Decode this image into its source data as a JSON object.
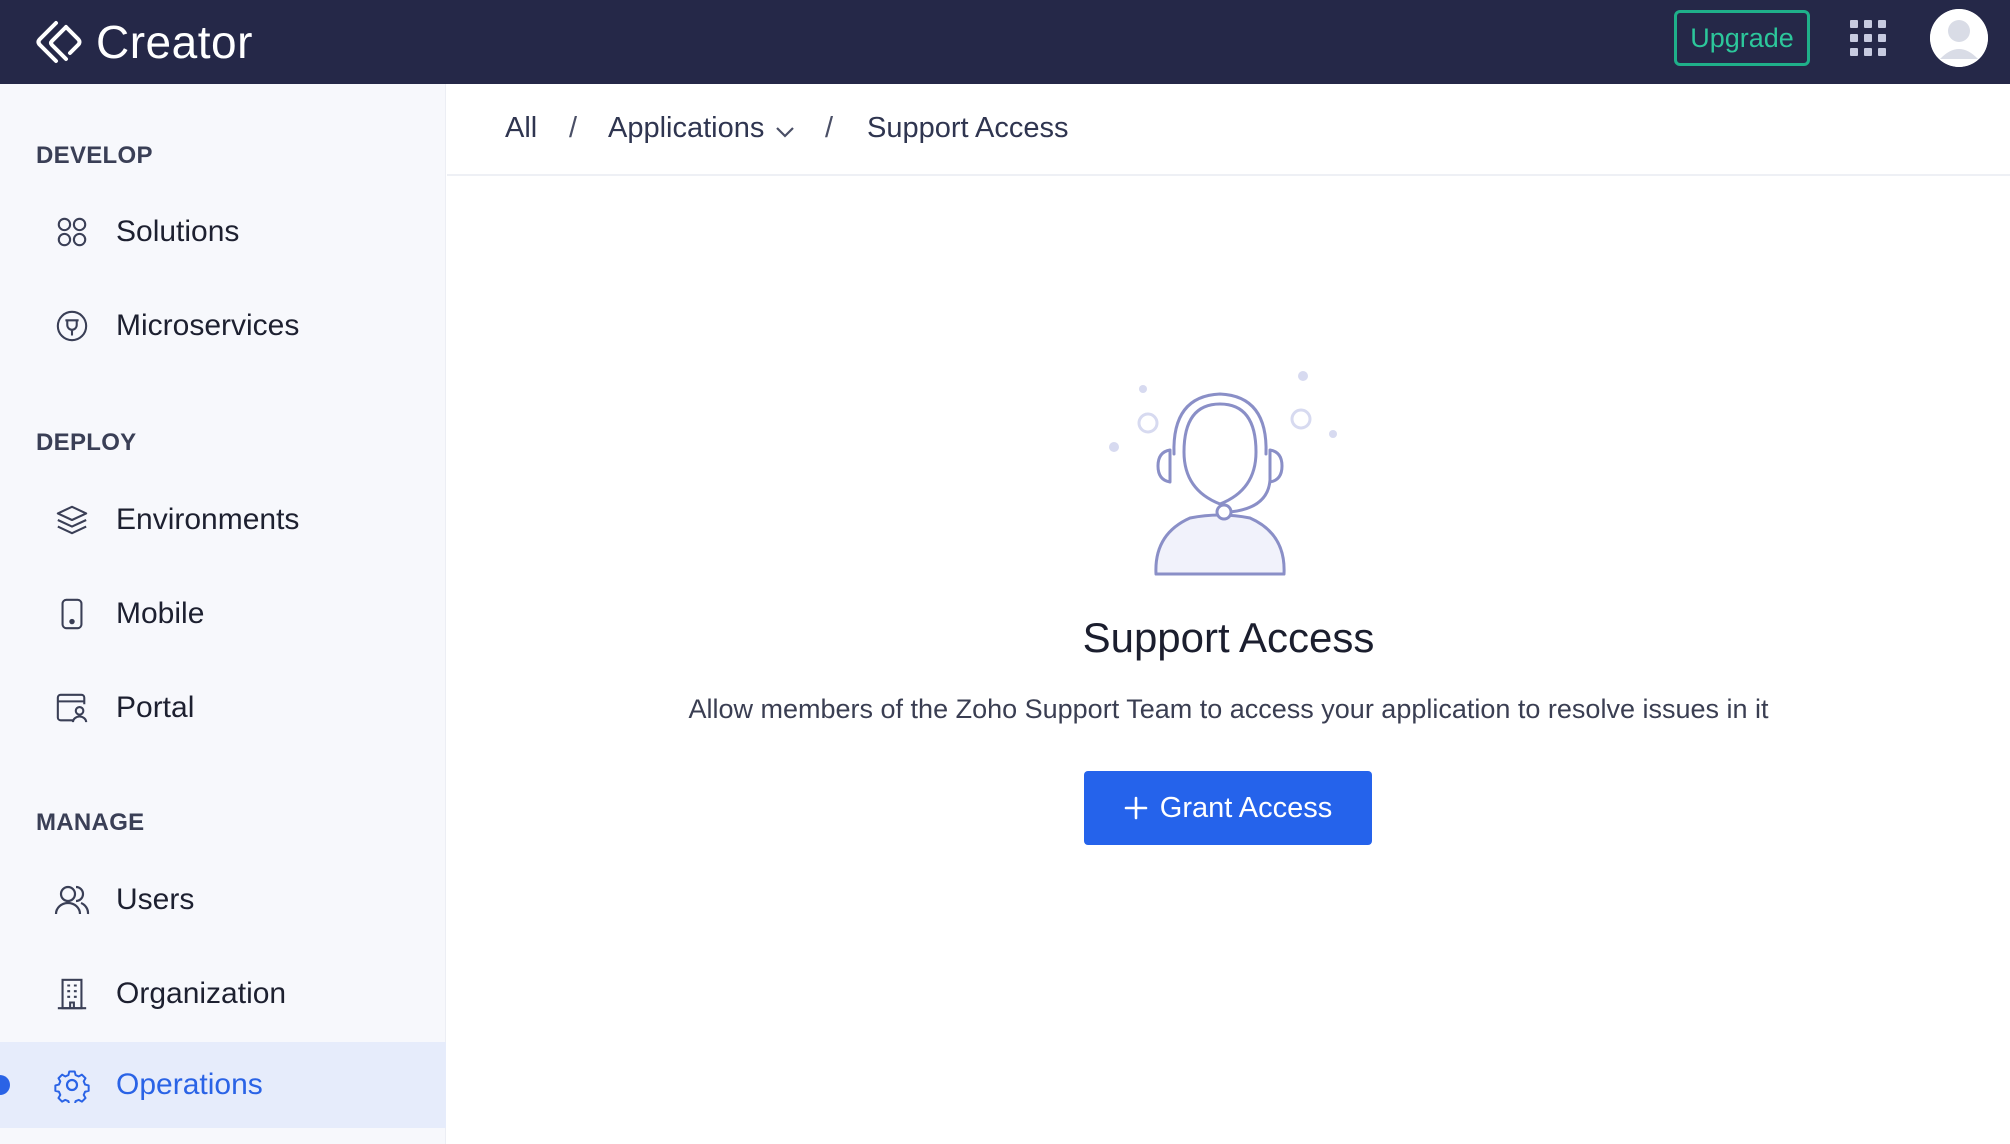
{
  "app": {
    "name": "Creator",
    "upgrade_label": "Upgrade"
  },
  "sidebar": {
    "sections": [
      {
        "title": "DEVELOP",
        "items": [
          {
            "label": "Solutions",
            "icon": "solutions-icon"
          },
          {
            "label": "Microservices",
            "icon": "microservices-icon"
          }
        ]
      },
      {
        "title": "DEPLOY",
        "items": [
          {
            "label": "Environments",
            "icon": "layers-icon"
          },
          {
            "label": "Mobile",
            "icon": "mobile-icon"
          },
          {
            "label": "Portal",
            "icon": "portal-icon"
          }
        ]
      },
      {
        "title": "MANAGE",
        "items": [
          {
            "label": "Users",
            "icon": "users-icon"
          },
          {
            "label": "Organization",
            "icon": "building-icon"
          },
          {
            "label": "Operations",
            "icon": "gear-icon",
            "active": true
          }
        ]
      }
    ]
  },
  "breadcrumb": {
    "all": "All",
    "separator": "/",
    "applications": "Applications",
    "current": "Support Access"
  },
  "empty_state": {
    "illustration": "support-agent-icon",
    "title": "Support Access",
    "description": "Allow members of the Zoho Support Team to access your application to resolve issues in it",
    "button_label": "Grant Access"
  },
  "colors": {
    "topbar": "#252848",
    "accent": "#2563eb",
    "upgrade": "#1fb08a",
    "sidebar_bg": "#f7f8fc",
    "active_bg": "#e6ecfb"
  }
}
